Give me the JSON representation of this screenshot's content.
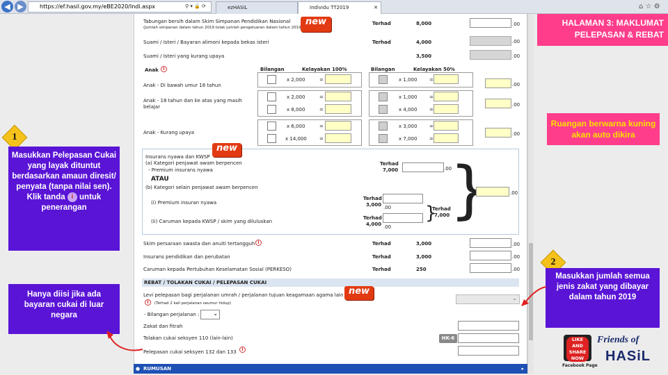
{
  "browser": {
    "url": "https://ef.hasil.gov.my/eBE2020/Indi.aspx",
    "tabs": [
      "ezHASiL",
      "Individu TT2019"
    ]
  },
  "header": {
    "title_line1": "HALAMAN 3: MAKLUMAT",
    "title_line2": "PELEPASAN & REBAT"
  },
  "rows": {
    "tabungan": "Tabungan bersih dalam Skim Simpanan Pendidikan Nasional",
    "tabungan_note": "(Jumlah simpanan dalam tahun 2019 tolak jumlah pengeluaran dalam tahun 2019)",
    "suami": "Suami / Isteri / Bayaran alimoni kepada bekas isteri",
    "suami_upaya": "Suami / Isteri yang kurang upaya",
    "anak": "Anak",
    "anak_bawah": "Anak - Di bawah umur 18 tahun",
    "anak_atas": "Anak - 18 tahun dan ke atas yang masih",
    "anak_atas2": "belajar",
    "anak_upaya": "Anak - Kurang upaya",
    "insurans": "Insurans nyawa dan KWSP",
    "kat_a": "(a) Kategori penjawat awam berpencen",
    "premium": "- Premium insurans nyawa",
    "atau": "ATAU",
    "kat_b": "(b) Kategori selain penjawat awam berpencen",
    "premium_i": "(i) Premium insuran nyawa",
    "caruman_ii": "(ii) Caruman kepada KWSP / skim yang diluluskan",
    "skim": "Skim persaraan swasta dan anuiti tertangguh",
    "insurans_pend": "Insurans pendidikan dan perubatan",
    "perkeso": "Caruman kepada Pertubuhan Keselamatan Sosial (PERKESO)"
  },
  "terhad": "Terhad",
  "limits": {
    "tabungan": "8,000",
    "suami": "4,000",
    "suami_upaya": "3,500",
    "ins_a": "7,000",
    "ins_i": "3,000",
    "ins_ii": "4,000",
    "ins_total": "7,000",
    "skim": "3,000",
    "insurans_pend": "3,000",
    "perkeso": "250"
  },
  "cents": ".00",
  "eq": "=",
  "anak_table": {
    "bilangan": "Bilangan",
    "kel100": "Kelayakan 100%",
    "kel50": "Kelayakan 50%",
    "bawah100": "x 2,000",
    "bawah50": "x 1,000",
    "atas100a": "x 2,000",
    "atas100b": "x 8,000",
    "atas50a": "x 1,000",
    "atas50b": "x 4,000",
    "upaya100a": "x 6,000",
    "upaya100b": "x 14,000",
    "upaya50a": "x 3,000",
    "upaya50b": "x 7,000"
  },
  "rebat": {
    "section": "REBAT / TOLAKAN CUKAI / PELEPASAN CUKAI",
    "levi": "Levi pelepasan bagi perjalanan umrah / perjalanan tujuan keagamaan agama lain",
    "levi_note": "(Terhad 2 kali perjalanan seumur hidup)",
    "bilangan": "- Bilangan perjalanan :",
    "zakat": "Zakat dan fitrah",
    "tolakan": "Tolakan cukai seksyen 110 (lain-lain)",
    "hk6": "HK-6",
    "pelepasan": "Pelepasan cukai seksyen 132 dan 133"
  },
  "rumusan": "RUMUSAN",
  "new_badge": "new",
  "callouts": {
    "one_num": "1",
    "one_text": "Masukkan Pelepasan Cukai yang layak dituntut berdasarkan amaun diresit/ penyata (tanpa nilai sen).",
    "one_text2a": "Klik tanda",
    "one_text2b": "untuk",
    "one_text3": "penerangan",
    "two_num": "2",
    "two_text": "Masukkan jumlah semua jenis zakat yang dibayar dalam tahun 2019",
    "luar": "Hanya diisi jika ada bayaran cukai di luar negara",
    "kuning": "Ruangan berwarna kuning akan auto dikira"
  },
  "brand": {
    "like": "LIKE AND SHARE NOW",
    "fb": "Facebook Page",
    "friends": "Friends of",
    "hasil": "HASiL"
  },
  "colors": {
    "purple": "#5a14d6",
    "pink": "#ff3d8b",
    "yellow_field": "#ffffc6",
    "new": "#e23a12",
    "callout_yellow": "#ffe000"
  }
}
